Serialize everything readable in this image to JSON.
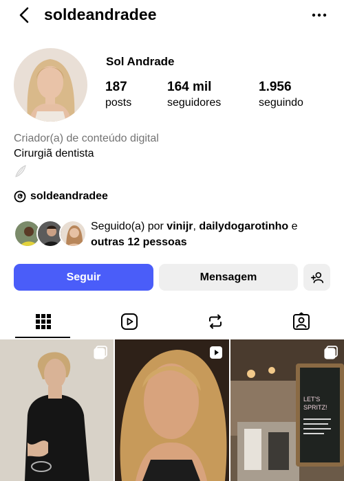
{
  "header": {
    "username": "soldeandradee",
    "back_icon": "chevron-left-icon",
    "more_icon": "ellipsis-icon"
  },
  "profile": {
    "full_name": "Sol Andrade",
    "stats": {
      "posts_count": "187",
      "posts_label": "posts",
      "followers_count": "164 mil",
      "followers_label": "seguidores",
      "following_count": "1.956",
      "following_label": "seguindo"
    },
    "category": "Criador(a) de conteúdo digital",
    "bio": "Cirurgiã dentista",
    "threads_handle": "soldeandradee"
  },
  "followed_by": {
    "prefix": "Seguido(a) por ",
    "user1": "vinijr",
    "separator": ", ",
    "user2": "dailydogarotinho",
    "connector": " e",
    "others": "outras 12 pessoas"
  },
  "actions": {
    "follow_label": "Seguir",
    "message_label": "Mensagem",
    "add_user_icon": "add-person-icon"
  },
  "tabs": [
    "grid-icon",
    "reels-icon",
    "reposts-icon",
    "tagged-icon"
  ],
  "colors": {
    "accent": "#4a5df9",
    "secondary_button": "#efefef",
    "muted_text": "#737373"
  }
}
